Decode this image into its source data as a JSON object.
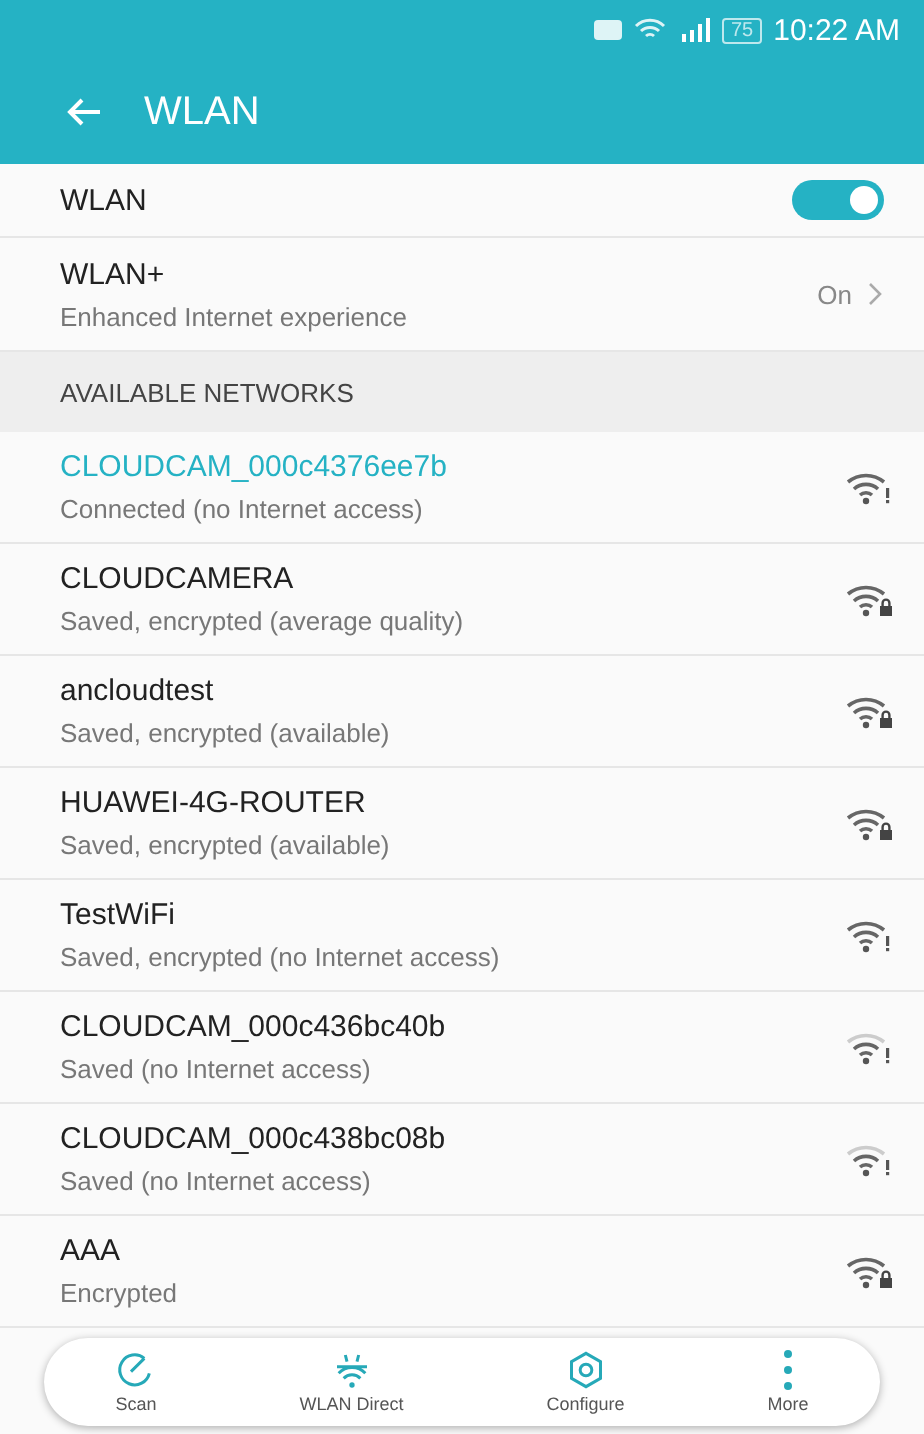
{
  "status_bar": {
    "battery": "75",
    "time": "10:22 AM"
  },
  "app_bar": {
    "title": "WLAN"
  },
  "wlan_toggle": {
    "label": "WLAN",
    "on": true
  },
  "wlan_plus": {
    "title": "WLAN+",
    "subtitle": "Enhanced Internet experience",
    "value": "On"
  },
  "section_header": "AVAILABLE NETWORKS",
  "networks": [
    {
      "name": "CLOUDCAM_000c4376ee7b",
      "status": "Connected (no Internet access)",
      "selected": true,
      "kind": "alert",
      "weak": false
    },
    {
      "name": "CLOUDCAMERA",
      "status": "Saved, encrypted (average quality)",
      "selected": false,
      "kind": "lock",
      "weak": false
    },
    {
      "name": "ancloudtest",
      "status": "Saved, encrypted (available)",
      "selected": false,
      "kind": "lock",
      "weak": false
    },
    {
      "name": "HUAWEI-4G-ROUTER",
      "status": "Saved, encrypted (available)",
      "selected": false,
      "kind": "lock",
      "weak": false
    },
    {
      "name": "TestWiFi",
      "status": "Saved, encrypted (no Internet access)",
      "selected": false,
      "kind": "alert",
      "weak": false
    },
    {
      "name": "CLOUDCAM_000c436bc40b",
      "status": "Saved (no Internet access)",
      "selected": false,
      "kind": "alert",
      "weak": true
    },
    {
      "name": "CLOUDCAM_000c438bc08b",
      "status": "Saved (no Internet access)",
      "selected": false,
      "kind": "alert",
      "weak": true
    },
    {
      "name": "AAA",
      "status": "Encrypted",
      "selected": false,
      "kind": "lock",
      "weak": false
    }
  ],
  "bottom_bar": [
    {
      "label": "Scan",
      "kind": "scan"
    },
    {
      "label": "WLAN Direct",
      "kind": "direct"
    },
    {
      "label": "Configure",
      "kind": "configure"
    },
    {
      "label": "More",
      "kind": "more"
    }
  ]
}
